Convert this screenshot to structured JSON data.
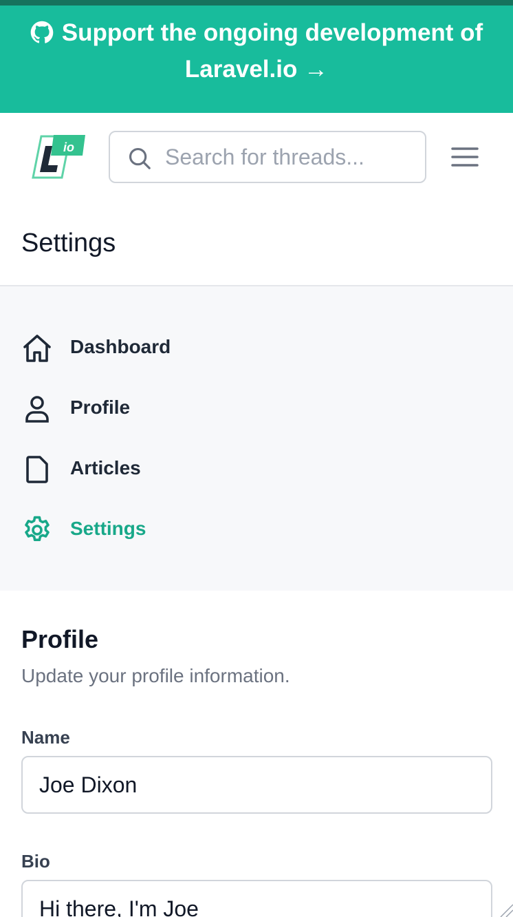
{
  "banner": {
    "text": "Support the ongoing development of Laravel.io →"
  },
  "header": {
    "search_placeholder": "Search for threads..."
  },
  "page": {
    "title": "Settings"
  },
  "nav": {
    "items": [
      {
        "label": "Dashboard",
        "icon": "home-icon",
        "active": false
      },
      {
        "label": "Profile",
        "icon": "user-icon",
        "active": false
      },
      {
        "label": "Articles",
        "icon": "document-icon",
        "active": false
      },
      {
        "label": "Settings",
        "icon": "gear-icon",
        "active": true
      }
    ]
  },
  "profile": {
    "title": "Profile",
    "subtitle": "Update your profile information.",
    "name_label": "Name",
    "name_value": "Joe Dixon",
    "bio_label": "Bio",
    "bio_value": "Hi there, I'm Joe"
  },
  "colors": {
    "brand": "#18bc9c",
    "brand_dark": "#16735d",
    "active_nav": "#18a889"
  }
}
